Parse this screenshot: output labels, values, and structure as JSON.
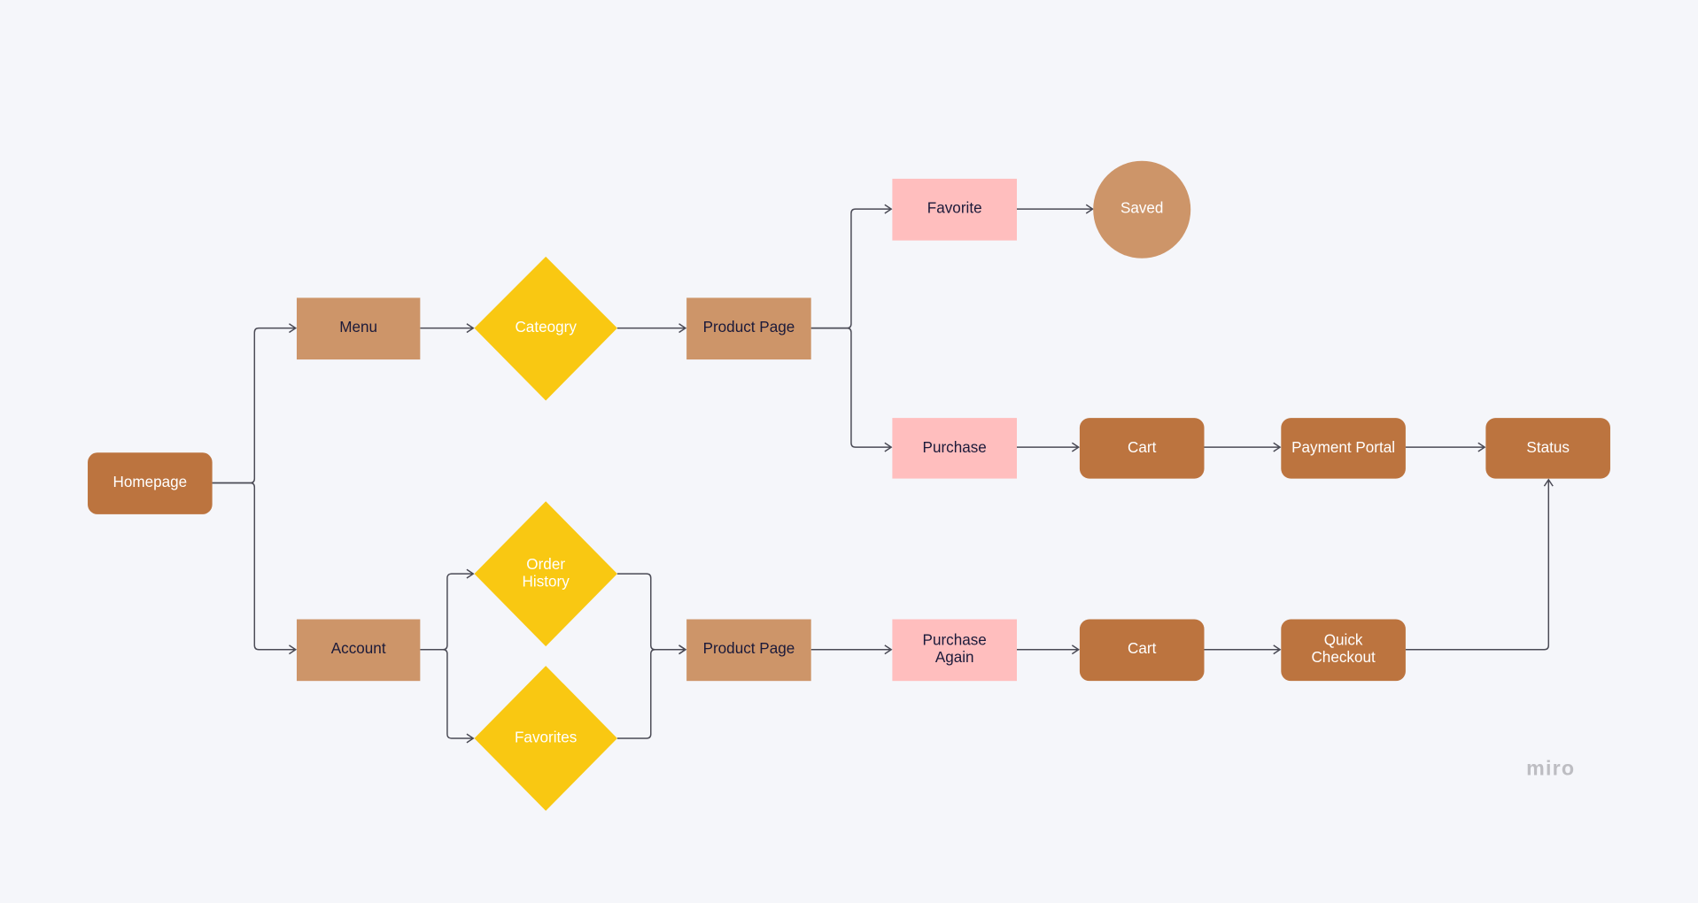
{
  "colors": {
    "background": "#f5f6fa",
    "terracotta": "#BC743F",
    "tan": "#CD9569",
    "yellow": "#F9C812",
    "pink": "#FFBEBE",
    "connector": "#4a4a55"
  },
  "nodes": {
    "homepage": "Homepage",
    "menu": "Menu",
    "category": "Cateogry",
    "product_page_top": "Product Page",
    "favorite": "Favorite",
    "saved": "Saved",
    "purchase": "Purchase",
    "cart_top": "Cart",
    "payment_portal": "Payment Portal",
    "status": "Status",
    "account": "Account",
    "order_history": [
      "Order",
      "History"
    ],
    "favorites": "Favorites",
    "product_page_bottom": "Product Page",
    "purchase_again": [
      "Purchase",
      "Again"
    ],
    "cart_bottom": "Cart",
    "quick_checkout": [
      "Quick",
      "Checkout"
    ]
  },
  "watermark": "miro"
}
